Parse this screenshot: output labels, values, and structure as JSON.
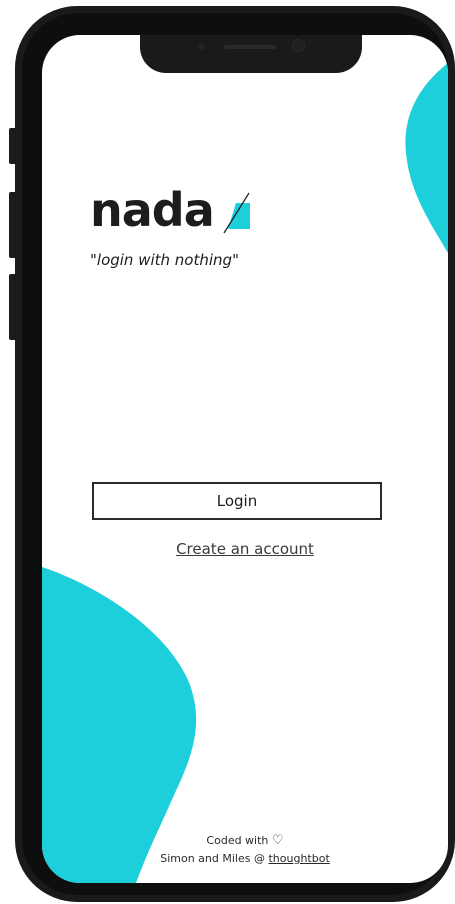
{
  "app": {
    "logo": "nada",
    "tagline": "\"login with nothing\""
  },
  "actions": {
    "login_label": "Login",
    "create_account_label": "Create an account"
  },
  "footer": {
    "coded_with": "Coded with",
    "heart_icon": "♡",
    "credit": "Simon and Miles @",
    "credit_link": "thoughtbot"
  },
  "colors": {
    "accent": "#1ccfdb",
    "text": "#1d1d1d",
    "device_frame": "#1a1a1a"
  }
}
